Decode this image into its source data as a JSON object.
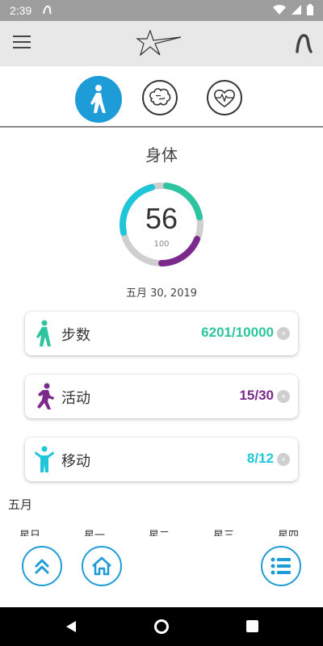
{
  "status_bar": {
    "time": "2:39"
  },
  "section": {
    "title": "身体"
  },
  "gauge": {
    "value": "56",
    "max": "100",
    "progress": 0.56
  },
  "date": "五月 30, 2019",
  "cards": {
    "steps": {
      "label": "步数",
      "value": "6201/10000",
      "color": "#2ec4a0"
    },
    "active": {
      "label": "活动",
      "value": "15/30",
      "color": "#7b2a8c"
    },
    "move": {
      "label": "移动",
      "value": "8/12",
      "color": "#1ec6d9"
    }
  },
  "calendar": {
    "month": "五月",
    "weekdays": [
      "星日",
      "星一",
      "星二",
      "星三",
      "星四"
    ]
  },
  "colors": {
    "accent": "#1e9cd7",
    "steps": "#2ec4a0",
    "active": "#7b2a8c",
    "move": "#1ec6d9"
  },
  "icons": {
    "tabs": [
      "walking-icon",
      "brain-icon",
      "heart-icon"
    ],
    "fabs": [
      "double-chevron-up-icon",
      "home-icon",
      "list-icon"
    ]
  }
}
